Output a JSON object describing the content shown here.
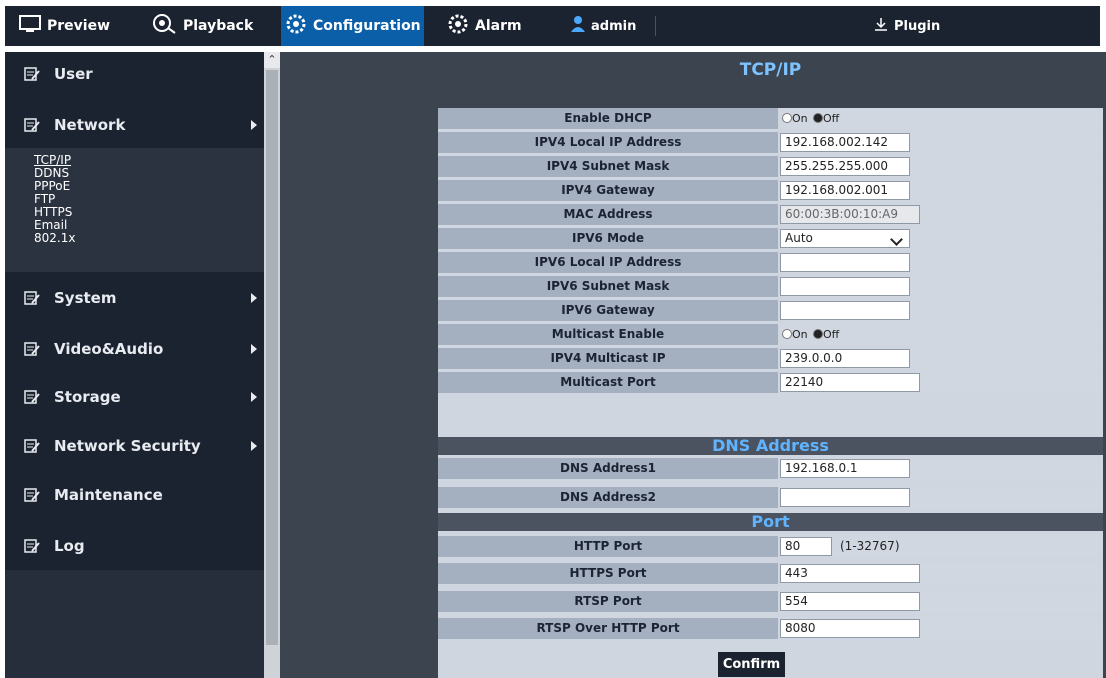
{
  "nav": {
    "preview": "Preview",
    "playback": "Playback",
    "configuration": "Configuration",
    "alarm": "Alarm",
    "user": "admin",
    "plugin": "Plugin"
  },
  "sidebar": {
    "items": {
      "user": "User",
      "network": "Network",
      "system": "System",
      "videoaudio": "Video&Audio",
      "storage": "Storage",
      "network_security": "Network Security",
      "maintenance": "Maintenance",
      "log": "Log"
    },
    "network_sub": [
      "TCP/IP",
      "DDNS",
      "PPPoE",
      "FTP",
      "HTTPS",
      "Email",
      "802.1x"
    ]
  },
  "page": {
    "title": "TCP/IP",
    "fields": {
      "enable_dhcp": {
        "label": "Enable DHCP",
        "on": "On",
        "off": "Off",
        "selected": "Off"
      },
      "ipv4_local_ip": {
        "label": "IPV4 Local IP Address",
        "value": "192.168.002.142"
      },
      "ipv4_subnet": {
        "label": "IPV4 Subnet Mask",
        "value": "255.255.255.000"
      },
      "ipv4_gateway": {
        "label": "IPV4 Gateway",
        "value": "192.168.002.001"
      },
      "mac": {
        "label": "MAC Address",
        "value": "60:00:3B:00:10:A9"
      },
      "ipv6_mode": {
        "label": "IPV6 Mode",
        "value": "Auto"
      },
      "ipv6_local_ip": {
        "label": "IPV6 Local IP Address",
        "value": ""
      },
      "ipv6_subnet": {
        "label": "IPV6 Subnet Mask",
        "value": ""
      },
      "ipv6_gateway": {
        "label": "IPV6 Gateway",
        "value": ""
      },
      "multicast_enable": {
        "label": "Multicast Enable",
        "on": "On",
        "off": "Off",
        "selected": "Off"
      },
      "ipv4_multicast_ip": {
        "label": "IPV4 Multicast IP",
        "value": "239.0.0.0"
      },
      "multicast_port": {
        "label": "Multicast Port",
        "value": "22140"
      }
    },
    "dns": {
      "section": "DNS Address",
      "dns1": {
        "label": "DNS Address1",
        "value": "192.168.0.1"
      },
      "dns2": {
        "label": "DNS Address2",
        "value": ""
      }
    },
    "port": {
      "section": "Port",
      "http": {
        "label": "HTTP Port",
        "value": "80",
        "hint": "(1-32767)"
      },
      "https": {
        "label": "HTTPS Port",
        "value": "443"
      },
      "rtsp": {
        "label": "RTSP Port",
        "value": "554"
      },
      "rtsp_http": {
        "label": "RTSP Over HTTP Port",
        "value": "8080"
      }
    },
    "confirm": "Confirm"
  }
}
